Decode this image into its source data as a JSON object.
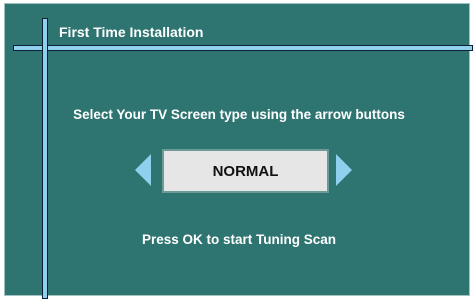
{
  "screen": {
    "title": "First Time Installation",
    "instruction": "Select Your TV Screen type using the arrow buttons",
    "selected_value": "NORMAL",
    "hint": "Press OK to start Tuning Scan"
  },
  "icons": {
    "left_arrow": "arrow-left-icon",
    "right_arrow": "arrow-right-icon"
  },
  "colors": {
    "background": "#2e7571",
    "accent": "#8fd0ee",
    "value_box": "#e6e6e6",
    "text": "#ffffff",
    "value_text": "#111111"
  }
}
